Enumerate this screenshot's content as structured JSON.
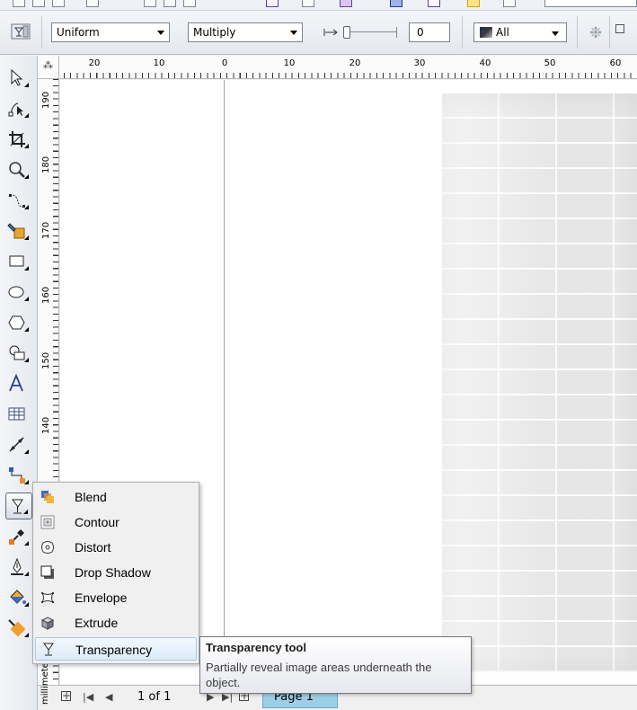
{
  "property_bar": {
    "transparency_type": "Uniform",
    "merge_mode": "Multiply",
    "transparency_value": "0",
    "target": "All"
  },
  "ruler": {
    "horizontal_labels": [
      "20",
      "10",
      "0",
      "10",
      "20",
      "30",
      "40",
      "50",
      "60"
    ],
    "vertical_labels": [
      "190",
      "180",
      "170",
      "160",
      "150",
      "140"
    ],
    "corner_glyph": "⁂",
    "units": "millimeters"
  },
  "toolbox": {
    "tools": [
      "pick-tool",
      "shape-tool",
      "crop-tool",
      "zoom-tool",
      "freehand-tool",
      "smart-fill-tool",
      "rectangle-tool",
      "ellipse-tool",
      "polygon-tool",
      "basic-shapes-tool",
      "text-tool",
      "table-tool",
      "parallel-dimension-tool",
      "connector-tool",
      "transparency-tool",
      "color-eyedropper-tool",
      "outline-pen-tool",
      "fill-tool",
      "interactive-fill-tool"
    ]
  },
  "flyout": {
    "items": [
      {
        "label": "Blend",
        "icon": "blend-icon"
      },
      {
        "label": "Contour",
        "icon": "contour-icon"
      },
      {
        "label": "Distort",
        "icon": "distort-icon"
      },
      {
        "label": "Drop Shadow",
        "icon": "drop-shadow-icon"
      },
      {
        "label": "Envelope",
        "icon": "envelope-icon"
      },
      {
        "label": "Extrude",
        "icon": "extrude-icon"
      },
      {
        "label": "Transparency",
        "icon": "transparency-icon"
      }
    ],
    "highlighted": "Transparency"
  },
  "tooltip": {
    "title": "Transparency tool",
    "description": "Partially reveal image areas underneath the object."
  },
  "page_nav": {
    "page_count": "1 of 1",
    "page_tab": "Page 1"
  },
  "colors": {
    "page_tab_bg": "#9ccfe6",
    "highlight_bg": "#dcebf9",
    "brick_wall": "#e6e6e6"
  }
}
